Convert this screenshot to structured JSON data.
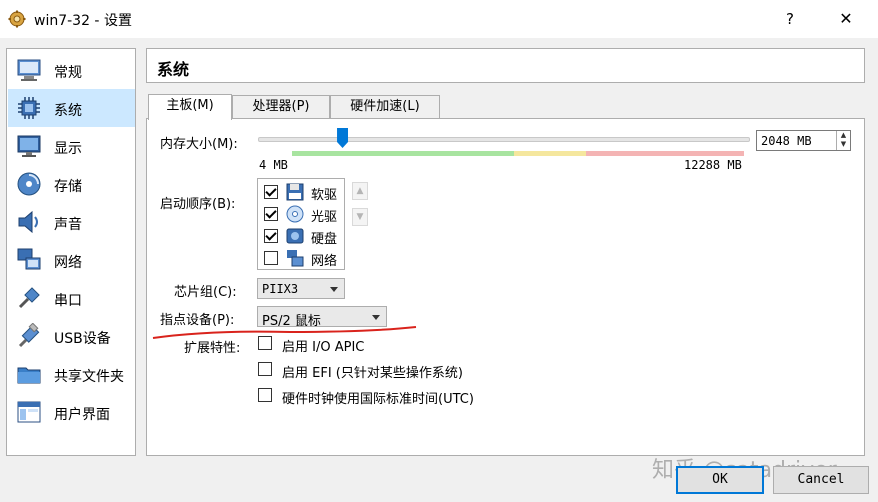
{
  "window": {
    "title": "win7-32 - 设置",
    "help": "?",
    "close": "✕"
  },
  "sidebar": {
    "items": [
      {
        "label": "常规",
        "icon": "general-icon"
      },
      {
        "label": "系统",
        "icon": "system-icon",
        "active": true
      },
      {
        "label": "显示",
        "icon": "display-icon"
      },
      {
        "label": "存储",
        "icon": "storage-icon"
      },
      {
        "label": "声音",
        "icon": "audio-icon"
      },
      {
        "label": "网络",
        "icon": "network-icon"
      },
      {
        "label": "串口",
        "icon": "serial-port-icon"
      },
      {
        "label": "USB设备",
        "icon": "usb-icon"
      },
      {
        "label": "共享文件夹",
        "icon": "shared-folder-icon"
      },
      {
        "label": "用户界面",
        "icon": "user-interface-icon"
      }
    ]
  },
  "section": {
    "title": "系统"
  },
  "tabs": [
    {
      "label": "主板(M)",
      "active": true
    },
    {
      "label": "处理器(P)"
    },
    {
      "label": "硬件加速(L)"
    }
  ],
  "memory": {
    "label": "内存大小(M):",
    "value": "2048 MB",
    "min_label": "4 MB",
    "max_label": "12288 MB",
    "value_mb": 2048,
    "min_mb": 4,
    "max_mb": 12288
  },
  "boot_order": {
    "label": "启动顺序(B):",
    "items": [
      {
        "label": "软驱",
        "checked": true,
        "icon": "floppy-icon"
      },
      {
        "label": "光驱",
        "checked": true,
        "icon": "optical-drive-icon"
      },
      {
        "label": "硬盘",
        "checked": true,
        "icon": "hard-disk-icon"
      },
      {
        "label": "网络",
        "checked": false,
        "icon": "network-boot-icon"
      }
    ],
    "up": "▲",
    "down": "▼"
  },
  "chipset": {
    "label": "芯片组(C):",
    "value": "PIIX3"
  },
  "pointing": {
    "label": "指点设备(P):",
    "value": "PS/2 鼠标"
  },
  "extended": {
    "label": "扩展特性:",
    "options": [
      {
        "label": "启用 I/O APIC",
        "checked": false
      },
      {
        "label": "启用 EFI (只针对某些操作系统)",
        "checked": false
      },
      {
        "label": "硬件时钟使用国际标准时间(UTC)",
        "checked": false
      }
    ]
  },
  "buttons": {
    "ok": "OK",
    "cancel": "Cancel"
  },
  "watermark": "知乎 @satadriver",
  "colors": {
    "accent": "#0078d7",
    "selection": "#cce8ff",
    "scale_green": "#a8e4a0",
    "scale_yellow": "#f5e79e",
    "scale_red": "#f4b4b4",
    "annotation": "#d9231c"
  }
}
